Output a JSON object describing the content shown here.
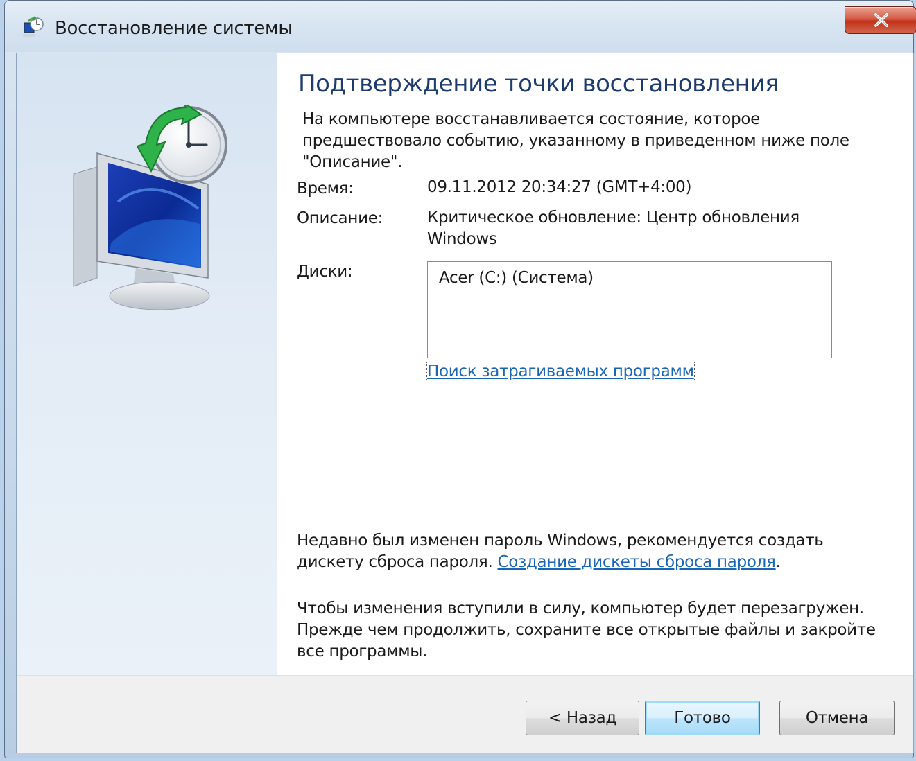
{
  "window": {
    "title": "Восстановление системы"
  },
  "content": {
    "heading": "Подтверждение точки восстановления",
    "intro": "На компьютере восстанавливается состояние, которое предшествовало событию, указанному в приведенном ниже поле \"Описание\".",
    "time_label": "Время:",
    "time_value": "09.11.2012 20:34:27 (GMT+4:00)",
    "description_label": "Описание:",
    "description_value": "Критическое обновление: Центр обновления Windows",
    "drives_label": "Диски:",
    "drives": [
      "Acer (C:) (Система)"
    ],
    "scan_link": "Поиск затрагиваемых программ",
    "password_note": "Недавно был изменен пароль Windows, рекомендуется создать дискету сброса пароля.",
    "password_link": "Создание дискеты сброса пароля",
    "password_link_suffix": ".",
    "restart_note": "Чтобы изменения вступили в силу, компьютер будет перезагружен. Прежде чем продолжить, сохраните все открытые файлы и закройте все программы."
  },
  "buttons": {
    "back": "< Назад",
    "finish": "Готово",
    "cancel": "Отмена"
  },
  "colors": {
    "heading": "#1e3b6e",
    "link": "#1a66b5",
    "close_button": "#c3321b"
  }
}
